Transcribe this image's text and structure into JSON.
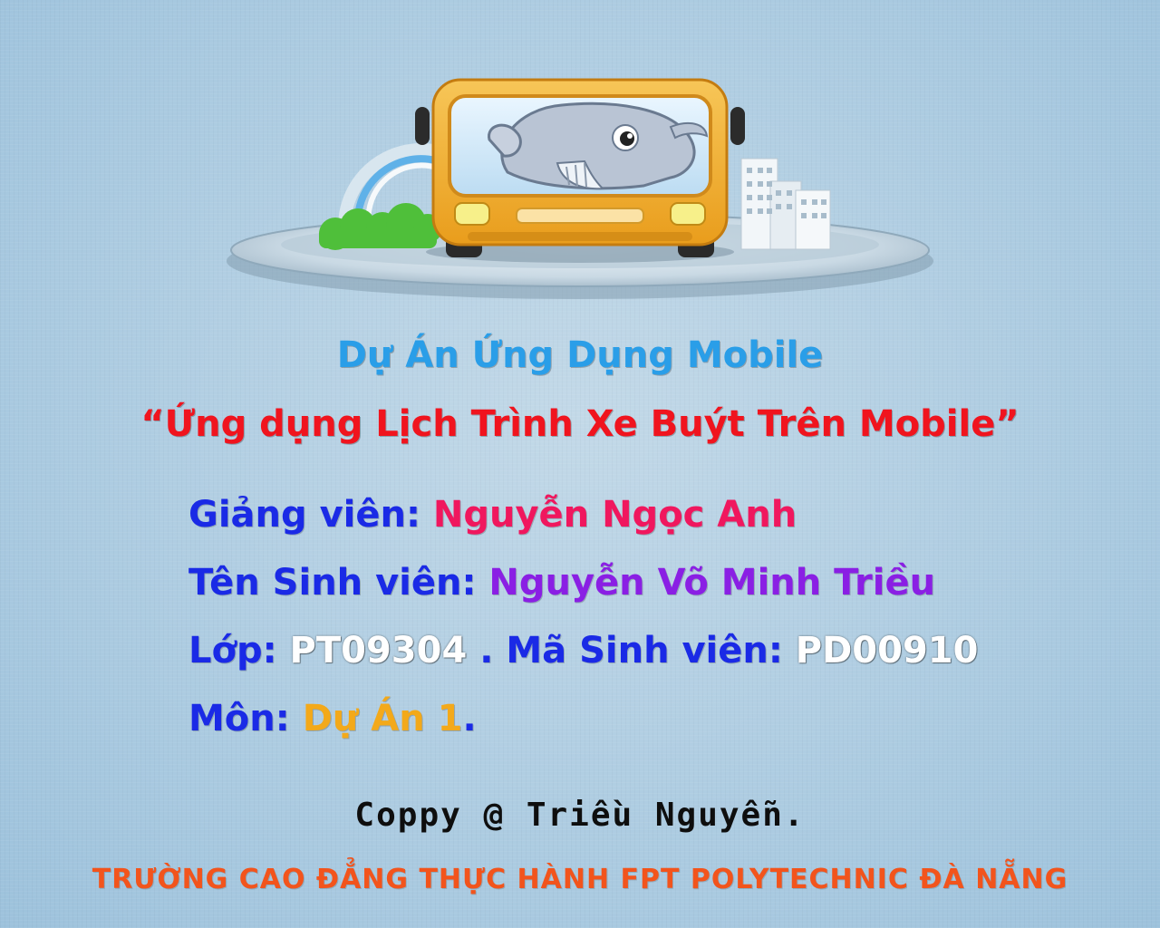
{
  "title_line1": "Dự Án Ứng Dụng Mobile",
  "title_line2": "“Ứng dụng Lịch Trình Xe Buýt Trên Mobile”",
  "lecturer": {
    "label": "Giảng viên: ",
    "value": "Nguyễn Ngọc Anh"
  },
  "student": {
    "label": "Tên Sinh viên: ",
    "value": "Nguyễn Võ Minh Triều"
  },
  "class_info": {
    "label": "Lớp: ",
    "value": "PT09304",
    "separator": " . ",
    "id_label": "Mã Sinh viên: ",
    "id_value": "PD00910"
  },
  "subject": {
    "label": "Môn: ",
    "value": "Dự Án 1",
    "suffix": "."
  },
  "copyright": "Coppy @ Triều Nguyễn.",
  "school": "TRƯỜNG CAO ĐẲNG THỰC HÀNH FPT POLYTECHNIC ĐÀ NẴNG",
  "colors": {
    "background": "#b2cfe3",
    "title_blue": "#2a9ee8",
    "title_red": "#f0141e",
    "label_blue": "#1a2ae6",
    "value_pink": "#f0175e",
    "value_purple": "#8a1fe4",
    "value_white": "#ffffff",
    "value_orange": "#f3a91a",
    "copyright": "#0e0e0e",
    "school": "#f2541c",
    "bus_body": "#f2b233"
  },
  "logo": {
    "icon": "bus-with-whale-mascot-icon"
  }
}
